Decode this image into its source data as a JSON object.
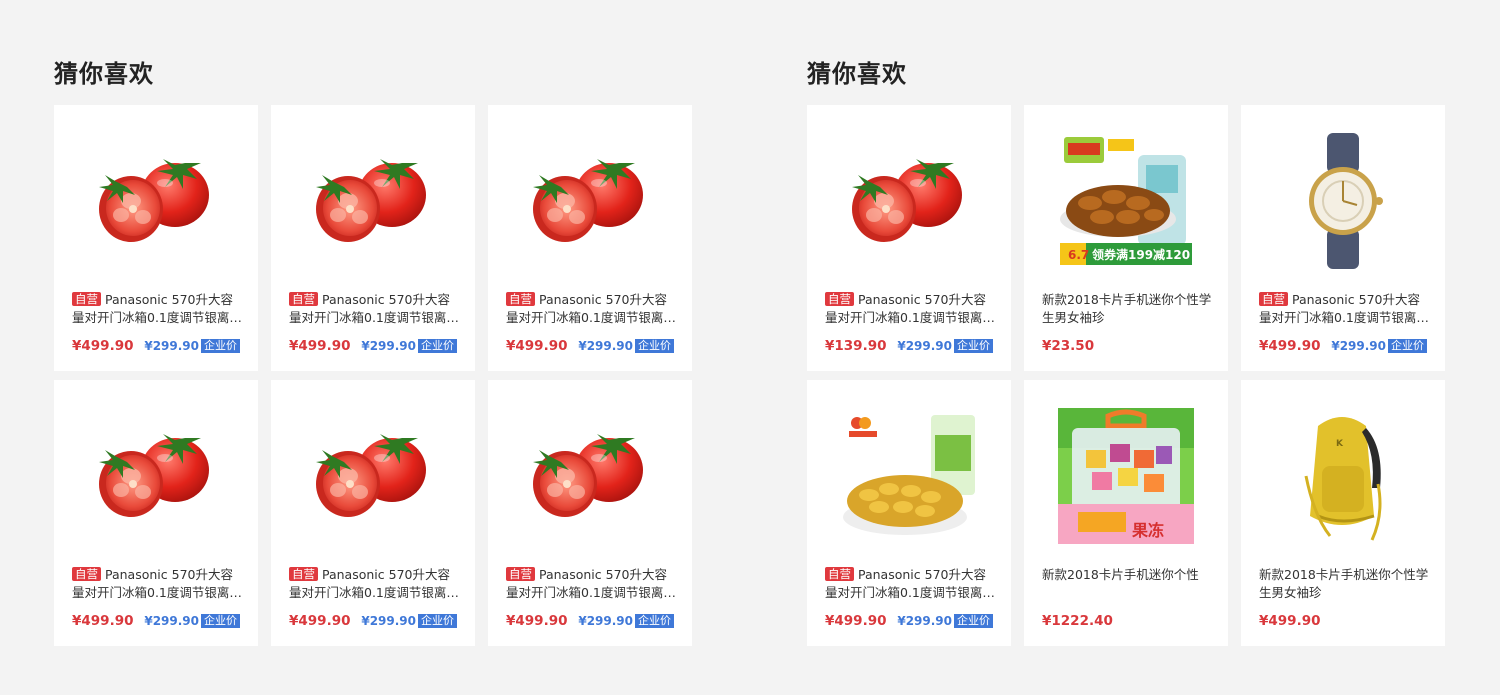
{
  "sections": [
    {
      "title": "猜你喜欢",
      "products": [
        {
          "image": "tomato",
          "self_badge": "自营",
          "name": "Panasonic 570升大容量对开门冰箱0.1度调节银离子…",
          "price": "¥499.90",
          "corp_price": "¥299.90",
          "corp_label": "企业价"
        },
        {
          "image": "tomato",
          "self_badge": "自营",
          "name": "Panasonic 570升大容量对开门冰箱0.1度调节银离子…",
          "price": "¥499.90",
          "corp_price": "¥299.90",
          "corp_label": "企业价"
        },
        {
          "image": "tomato",
          "self_badge": "自营",
          "name": "Panasonic 570升大容量对开门冰箱0.1度调节银离子…",
          "price": "¥499.90",
          "corp_price": "¥299.90",
          "corp_label": "企业价"
        },
        {
          "image": "tomato",
          "self_badge": "自营",
          "name": "Panasonic 570升大容量对开门冰箱0.1度调节银离子…",
          "price": "¥499.90",
          "corp_price": "¥299.90",
          "corp_label": "企业价"
        },
        {
          "image": "tomato",
          "self_badge": "自营",
          "name": "Panasonic 570升大容量对开门冰箱0.1度调节银离子…",
          "price": "¥499.90",
          "corp_price": "¥299.90",
          "corp_label": "企业价"
        },
        {
          "image": "tomato",
          "self_badge": "自营",
          "name": "Panasonic 570升大容量对开门冰箱0.1度调节银离子…",
          "price": "¥499.90",
          "corp_price": "¥299.90",
          "corp_label": "企业价"
        }
      ]
    },
    {
      "title": "猜你喜欢",
      "products": [
        {
          "image": "tomato",
          "self_badge": "自营",
          "name": "Panasonic 570升大容量对开门冰箱0.1度调节银离子…",
          "price": "¥139.90",
          "corp_price": "¥299.90",
          "corp_label": "企业价"
        },
        {
          "image": "nuts-snack",
          "self_badge": null,
          "name": "新款2018卡片手机迷你个性学生男女袖珍",
          "price": "¥23.50",
          "corp_price": null,
          "corp_label": null,
          "promo_text": "领券满199减120",
          "promo_tag": "6.7"
        },
        {
          "image": "wristwatch",
          "self_badge": "自营",
          "name": "Panasonic 570升大容量对开门冰箱0.1度调节银离子…",
          "price": "¥499.90",
          "corp_price": "¥299.90",
          "corp_label": "企业价"
        },
        {
          "image": "raisins",
          "self_badge": "自营",
          "name": "Panasonic 570升大容量对开门冰箱0.1度调节银离子…",
          "price": "¥499.90",
          "corp_price": "¥299.90",
          "corp_label": "企业价"
        },
        {
          "image": "jelly-box",
          "self_badge": null,
          "name": "新款2018卡片手机迷你个性",
          "price": "¥1222.40",
          "corp_price": null,
          "corp_label": null,
          "promo_text": "果冻"
        },
        {
          "image": "backpack",
          "self_badge": null,
          "name": "新款2018卡片手机迷你个性学生男女袖珍",
          "price": "¥499.90",
          "corp_price": null,
          "corp_label": null
        }
      ]
    }
  ],
  "colors": {
    "background": "#f3f3f3",
    "card": "#ffffff",
    "price_red": "#d9383c",
    "self_badge_red": "#e0393e",
    "corp_blue": "#3f78d8",
    "title_text": "#222222"
  }
}
